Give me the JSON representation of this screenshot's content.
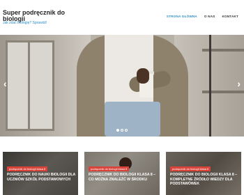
{
  "header": {
    "site_title": "Super podręcznik do biologii",
    "tagline": "Jak zdać biologię? Sprawdź!",
    "nav": [
      {
        "label": "STRONA GŁÓWNA",
        "active": true
      },
      {
        "label": "O NAS",
        "active": false
      },
      {
        "label": "KONTAKT",
        "active": false
      }
    ]
  },
  "slider": {
    "prev_icon": "‹",
    "next_icon": "›",
    "slide_count": 3,
    "active_slide": 1
  },
  "cards": [
    {
      "category": "podręcznik do biologii klasa 8",
      "title": "PODRĘCZNIK DO NAUKI BIOLOGII DLA UCZNIÓW SZKÓŁ PODSTAWOWYCH"
    },
    {
      "category": "podręcznik do biologii klasa 8",
      "title": "PODRĘCZNIK DO BIOLOGII KLASA 8 – CO MOŻNA ZNALEŹĆ W ŚRODKU"
    },
    {
      "category": "podręcznik do biologii klasa 8",
      "title": "PODRĘCZNIK DO BIOLOGII KLASA 8 – KOMPLETNE ŹRÓDŁO WIEDZY DLA PODSTAWÓWEK"
    }
  ],
  "colors": {
    "accent": "#2a8ec7",
    "badge": "#d9433a"
  }
}
